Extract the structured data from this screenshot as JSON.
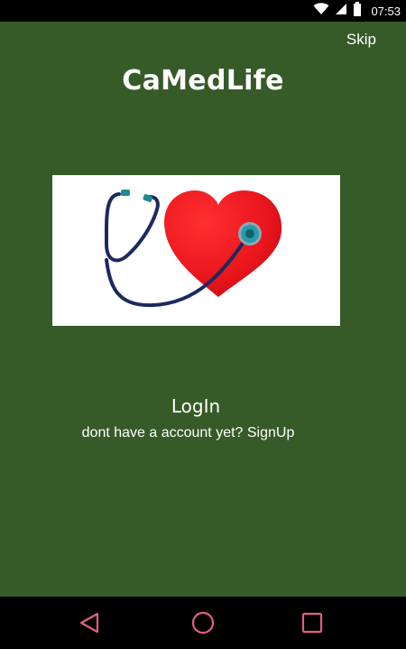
{
  "status_bar": {
    "time": "07:53",
    "icons": [
      "wifi-icon",
      "cell-signal-icon",
      "battery-icon"
    ]
  },
  "header": {
    "skip_label": "Skip",
    "app_title": "CaMedLife"
  },
  "hero": {
    "image": "stethoscope-heart-illustration"
  },
  "auth": {
    "login_label": "LogIn",
    "signup_prompt": "dont have a account yet? SignUp"
  },
  "nav_bar": {
    "buttons": [
      "back-icon",
      "home-icon",
      "recents-icon"
    ],
    "icon_color": "#e0607e"
  },
  "colors": {
    "background": "#365a28",
    "heart": "#e8141c",
    "stethoscope": "#1b2a5e",
    "chestpiece": "#2a9aa8"
  }
}
